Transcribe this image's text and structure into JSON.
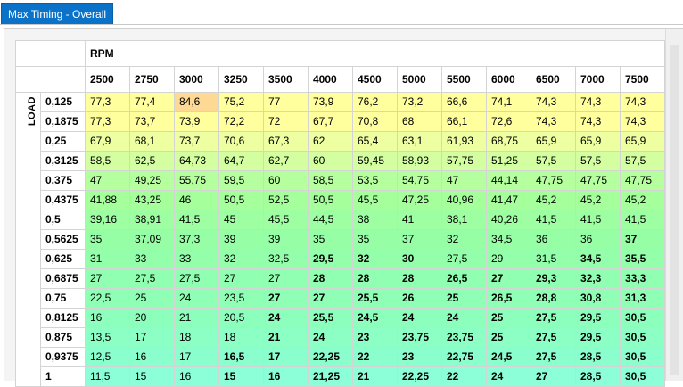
{
  "tab": {
    "label": "Max Timing - Overall"
  },
  "table": {
    "column_axis_label": "RPM",
    "row_axis_label": "LOAD",
    "rpm": [
      "2500",
      "2750",
      "3000",
      "3250",
      "3500",
      "4000",
      "4500",
      "5000",
      "5500",
      "6000",
      "6500",
      "7000",
      "7500"
    ],
    "load": [
      "0,125",
      "0,1875",
      "0,25",
      "0,3125",
      "0,375",
      "0,4375",
      "0,5",
      "0,5625",
      "0,625",
      "0,6875",
      "0,75",
      "0,8125",
      "0,875",
      "0,9375",
      "1"
    ],
    "rows": [
      [
        "77,3",
        "77,4",
        "84,6",
        "75,2",
        "77",
        "73,9",
        "76,2",
        "73,2",
        "66,6",
        "74,1",
        "74,3",
        "74,3",
        "74,3"
      ],
      [
        "77,3",
        "73,7",
        "73,9",
        "72,2",
        "72",
        "67,7",
        "70,8",
        "68",
        "66,1",
        "72,6",
        "74,3",
        "74,3",
        "74,3"
      ],
      [
        "67,9",
        "68,1",
        "73,7",
        "70,6",
        "67,3",
        "62",
        "65,4",
        "63,1",
        "61,93",
        "68,75",
        "65,9",
        "65,9",
        "65,9"
      ],
      [
        "58,5",
        "62,5",
        "64,73",
        "64,7",
        "62,7",
        "60",
        "59,45",
        "58,93",
        "57,75",
        "51,25",
        "57,5",
        "57,5",
        "57,5"
      ],
      [
        "47",
        "49,25",
        "55,75",
        "59,5",
        "60",
        "58,5",
        "53,5",
        "54,75",
        "47",
        "44,14",
        "47,75",
        "47,75",
        "47,75"
      ],
      [
        "41,88",
        "43,25",
        "46",
        "50,5",
        "52,5",
        "50,5",
        "45,5",
        "47,25",
        "40,96",
        "41,47",
        "45,2",
        "45,2",
        "45,2"
      ],
      [
        "39,16",
        "38,91",
        "41,5",
        "45",
        "45,5",
        "44,5",
        "38",
        "41",
        "38,1",
        "40,26",
        "41,5",
        "41,5",
        "41,5"
      ],
      [
        "35",
        "37,09",
        "37,3",
        "39",
        "39",
        "35",
        "35",
        "37",
        "32",
        "34,5",
        "36",
        "36",
        "37"
      ],
      [
        "31",
        "33",
        "33",
        "32",
        "32,5",
        "29,5",
        "32",
        "30",
        "27,5",
        "29",
        "31,5",
        "34,5",
        "35,5"
      ],
      [
        "27",
        "27,5",
        "27,5",
        "27",
        "27",
        "28",
        "28",
        "28",
        "26,5",
        "27",
        "29,3",
        "32,3",
        "33,3"
      ],
      [
        "22,5",
        "25",
        "24",
        "23,5",
        "27",
        "27",
        "25,5",
        "26",
        "25",
        "26,5",
        "28,8",
        "30,8",
        "31,3"
      ],
      [
        "16",
        "20",
        "21",
        "20,5",
        "24",
        "25,5",
        "24,5",
        "24",
        "24",
        "25",
        "27,5",
        "29,5",
        "30,5"
      ],
      [
        "13,5",
        "17",
        "18",
        "18",
        "21",
        "24",
        "23",
        "23,75",
        "23,75",
        "25",
        "27,5",
        "29,5",
        "30,5"
      ],
      [
        "12,5",
        "16",
        "17",
        "16,5",
        "17",
        "22,25",
        "22",
        "23",
        "22,75",
        "24,5",
        "27,5",
        "28,5",
        "30,5"
      ],
      [
        "11,5",
        "15",
        "16",
        "15",
        "16",
        "21,25",
        "21",
        "22,25",
        "22",
        "24",
        "27",
        "28,5",
        "30,5"
      ]
    ],
    "bold_cells": [
      [
        7,
        12
      ],
      [
        8,
        5
      ],
      [
        8,
        6
      ],
      [
        8,
        7
      ],
      [
        8,
        11
      ],
      [
        8,
        12
      ],
      [
        9,
        5
      ],
      [
        9,
        6
      ],
      [
        9,
        7
      ],
      [
        9,
        8
      ],
      [
        9,
        9
      ],
      [
        9,
        10
      ],
      [
        9,
        11
      ],
      [
        9,
        12
      ],
      [
        10,
        4
      ],
      [
        10,
        5
      ],
      [
        10,
        6
      ],
      [
        10,
        7
      ],
      [
        10,
        8
      ],
      [
        10,
        9
      ],
      [
        10,
        10
      ],
      [
        10,
        11
      ],
      [
        10,
        12
      ],
      [
        11,
        4
      ],
      [
        11,
        5
      ],
      [
        11,
        6
      ],
      [
        11,
        7
      ],
      [
        11,
        8
      ],
      [
        11,
        9
      ],
      [
        11,
        10
      ],
      [
        11,
        11
      ],
      [
        11,
        12
      ],
      [
        12,
        4
      ],
      [
        12,
        5
      ],
      [
        12,
        6
      ],
      [
        12,
        7
      ],
      [
        12,
        8
      ],
      [
        12,
        9
      ],
      [
        12,
        10
      ],
      [
        12,
        11
      ],
      [
        12,
        12
      ],
      [
        13,
        3
      ],
      [
        13,
        4
      ],
      [
        13,
        5
      ],
      [
        13,
        6
      ],
      [
        13,
        7
      ],
      [
        13,
        8
      ],
      [
        13,
        9
      ],
      [
        13,
        10
      ],
      [
        13,
        11
      ],
      [
        13,
        12
      ],
      [
        14,
        3
      ],
      [
        14,
        4
      ],
      [
        14,
        5
      ],
      [
        14,
        6
      ],
      [
        14,
        7
      ],
      [
        14,
        8
      ],
      [
        14,
        9
      ],
      [
        14,
        10
      ],
      [
        14,
        11
      ],
      [
        14,
        12
      ]
    ],
    "highlight_cell": [
      0,
      2
    ],
    "colors": {
      "row_colors": [
        "#ffff9e",
        "#ffff9e",
        "#eeffa2",
        "#d4ffa0",
        "#b6ff9e",
        "#a5ff9b",
        "#9dffa1",
        "#96ffa6",
        "#93ffab",
        "#91ffb1",
        "#8fffb6",
        "#8dffbd",
        "#8cffc4",
        "#8affcd",
        "#8cffd8"
      ],
      "highlight": "#fed994",
      "tab_active": "#0a72c9"
    }
  }
}
